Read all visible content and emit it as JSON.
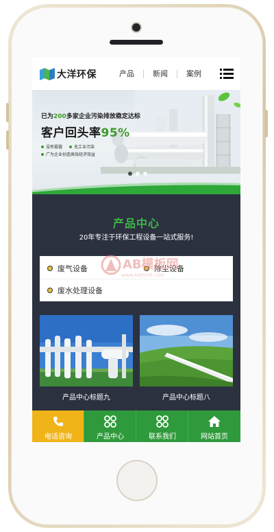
{
  "header": {
    "logo_text": "大洋环保",
    "nav": [
      "产品",
      "新闻",
      "案例"
    ]
  },
  "banner": {
    "line1_pre": "已为",
    "line1_num": "200",
    "line1_post": "多家企业污染排放稳定达标",
    "headline_pre": "客户回头率",
    "headline_pct": "95%",
    "bullets": [
      "没有雾霾",
      "无工业污染",
      "广为企业创造高效经济效益"
    ]
  },
  "products": {
    "title": "产品中心",
    "subtitle": "20年专注于环保工程设备一站式服务!",
    "categories": [
      "废气设备",
      "除尘设备",
      "废水处理设备"
    ],
    "cards": [
      {
        "caption": "产品中心标题九"
      },
      {
        "caption": "产品中心标题八"
      }
    ]
  },
  "watermark": {
    "text": "AB模板网",
    "url": "www.Admin5.com"
  },
  "bottom_bar": [
    {
      "label": "电话咨询",
      "icon": "phone-icon"
    },
    {
      "label": "产品中心",
      "icon": "grid-icon"
    },
    {
      "label": "联系我们",
      "icon": "grid-icon"
    },
    {
      "label": "网站首页",
      "icon": "home-icon"
    }
  ],
  "colors": {
    "accent_green": "#2f9a3b",
    "active_yellow": "#f0b419",
    "title_green": "#3fb548",
    "dark_bg": "#2c3140"
  }
}
